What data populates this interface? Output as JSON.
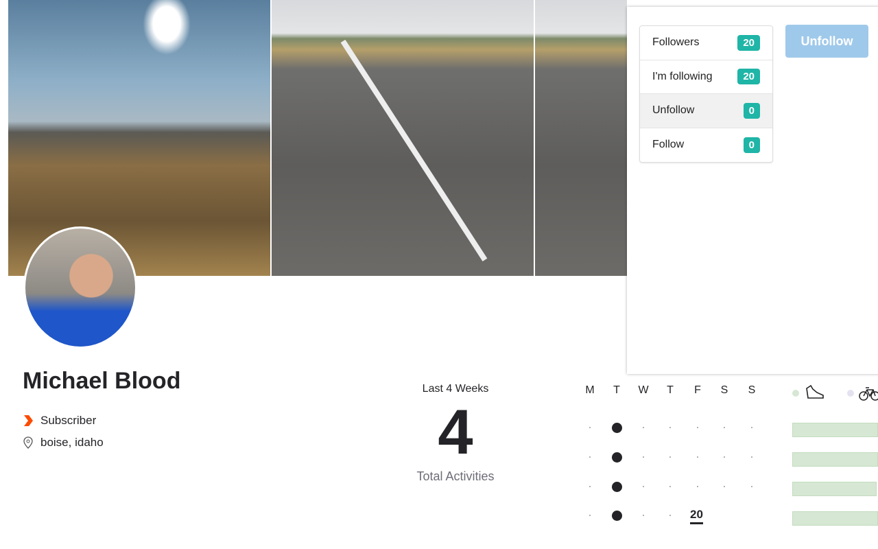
{
  "profile": {
    "name": "Michael Blood",
    "badge": "Subscriber",
    "location": "boise, idaho"
  },
  "stats": {
    "label": "Last 4 Weeks",
    "value": "4",
    "sublabel": "Total Activities"
  },
  "calendar": {
    "days": [
      "M",
      "T",
      "W",
      "T",
      "F",
      "S",
      "S"
    ],
    "today_label": "20",
    "weeks": [
      [
        0,
        1,
        0,
        0,
        0,
        0,
        0
      ],
      [
        0,
        1,
        0,
        0,
        0,
        0,
        0
      ],
      [
        0,
        1,
        0,
        0,
        0,
        0,
        0
      ],
      [
        0,
        1,
        0,
        0,
        "today"
      ]
    ]
  },
  "legend": [
    {
      "icon": "run-shoe-icon",
      "color": "#d6e7d3"
    },
    {
      "icon": "bike-icon",
      "color": "#e4e1f0"
    }
  ],
  "popup": {
    "items": [
      {
        "label": "Followers",
        "count": "20"
      },
      {
        "label": "I'm following",
        "count": "20"
      },
      {
        "label": "Unfollow",
        "count": "0",
        "active": true
      },
      {
        "label": "Follow",
        "count": "0"
      }
    ],
    "button": "Unfollow"
  },
  "colors": {
    "accent": "#1fb5a7",
    "button": "#9fc9ea",
    "subscriber": "#fc4c02"
  }
}
